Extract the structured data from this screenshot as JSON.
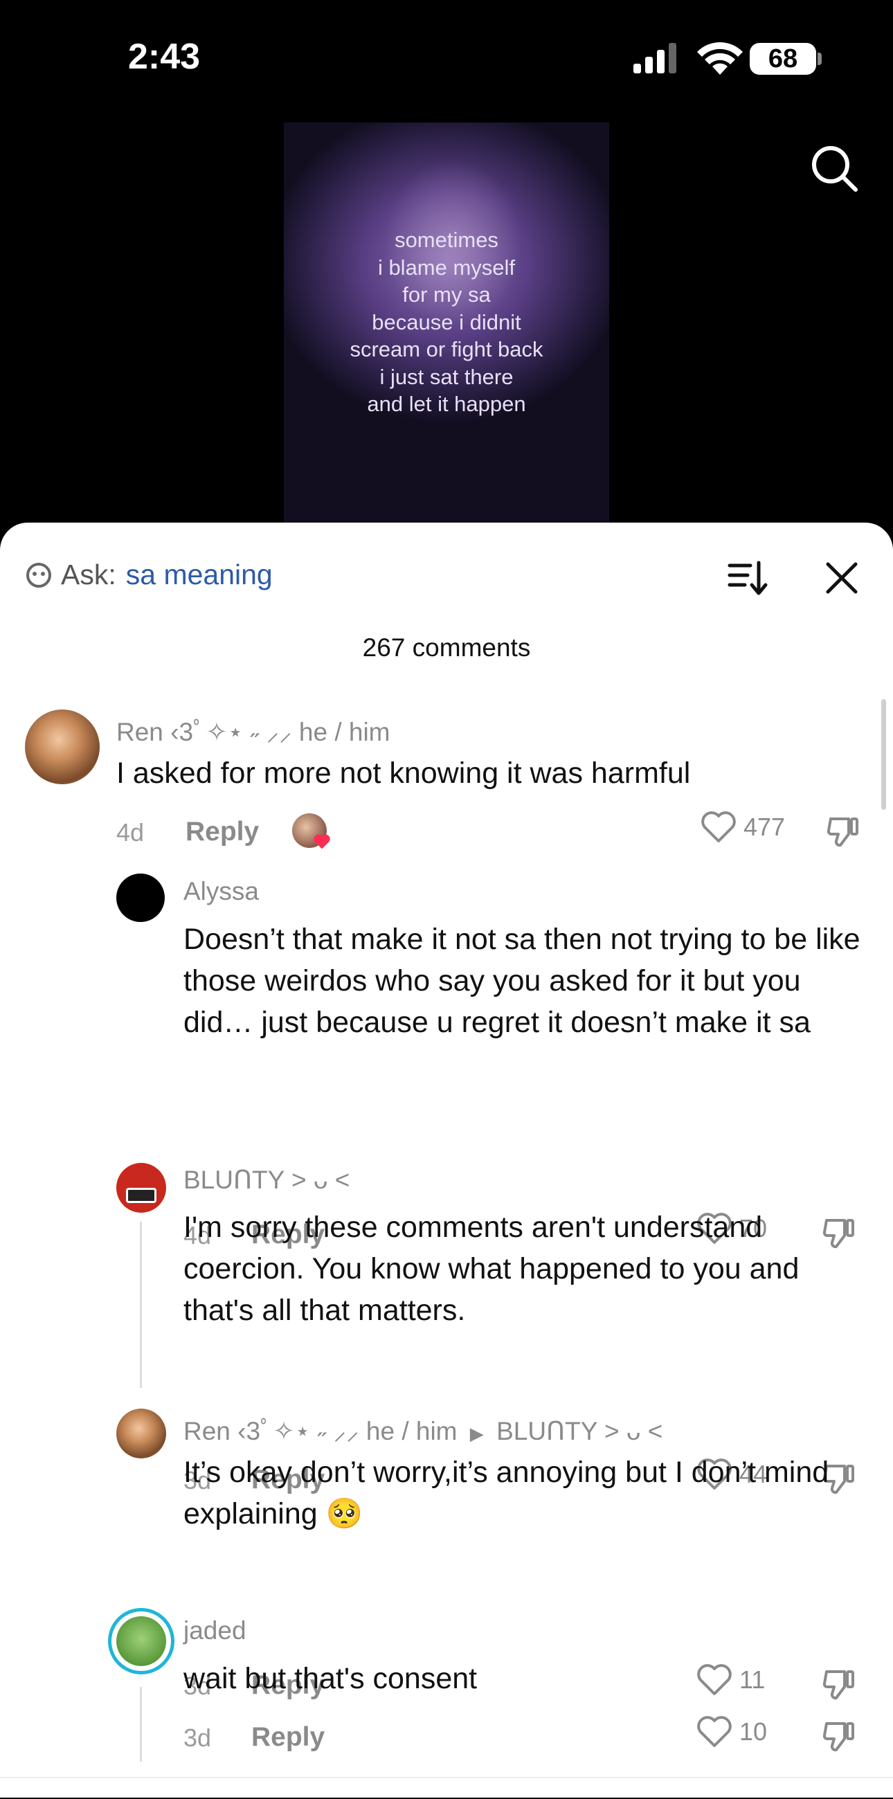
{
  "status_bar": {
    "time": "2:43",
    "battery": "68"
  },
  "video": {
    "caption_lines": [
      "sometimes",
      "i blame myself",
      "for my sa",
      "because i didnit",
      "scream or fight back",
      "i just sat there",
      "and let it happen"
    ]
  },
  "sheet": {
    "ask_label": "Ask:",
    "ask_query": "sa meaning",
    "count": "267 comments"
  },
  "comments": [
    {
      "user": "Ren ‹3ﾟ✧⋆ ˶ ⸝⸝ he / him",
      "text": "I asked for more not knowing it was harmful",
      "age": "4d",
      "reply": "Reply",
      "likes": "477"
    },
    {
      "user": "Alyssa",
      "text": "Doesn’t that make it not sa then not trying to be like those weirdos who say you asked for it but you did… just because u regret it doesn’t make it sa",
      "age": "4d",
      "reply": "Reply",
      "likes": "70"
    },
    {
      "user": "BLUᑎTY ˃ ᴗ ˂",
      "text": "I'm sorry these comments aren't understand coercion. You know what happened to you and that's all that matters.",
      "age": "3d",
      "reply": "Reply",
      "likes": "44"
    },
    {
      "user": "Ren ‹3ﾟ✧⋆ ˶ ⸝⸝ he / him",
      "reply_to": "BLUᑎTY ˃ ᴗ ˂",
      "text": "It’s okay don’t worry,it’s annoying but I don’t mind explaining 🥺",
      "age": "3d",
      "reply": "Reply",
      "likes": "11"
    },
    {
      "user": "jaded",
      "text": "wait but that's consent",
      "age": "3d",
      "reply": "Reply",
      "likes": "10"
    }
  ],
  "colors": {
    "link": "#2e5aa8",
    "muted": "#8a8a8a",
    "text": "#111111"
  }
}
